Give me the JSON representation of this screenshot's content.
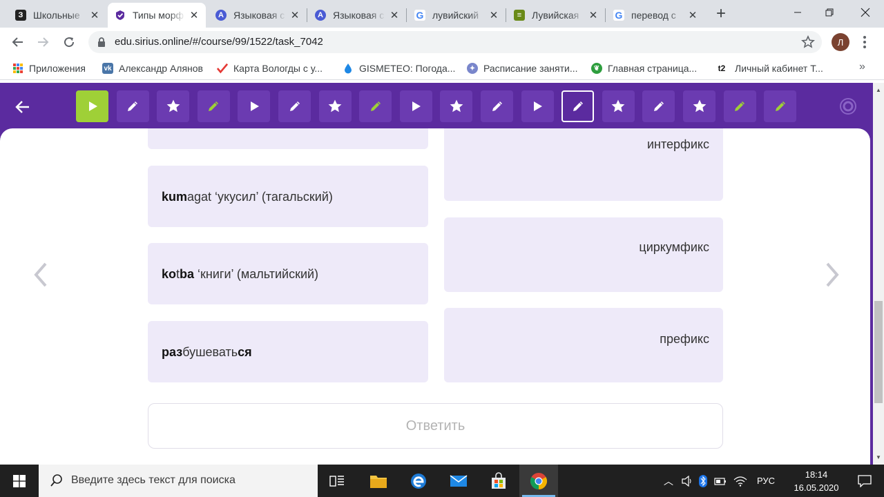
{
  "browser": {
    "tabs": [
      {
        "title": "Школьные",
        "favicon_text": "З",
        "favicon_color": "#222222"
      },
      {
        "title": "Типы морф",
        "favicon_text": "✓",
        "favicon_color": "#5b2b9f"
      },
      {
        "title": "Языковая с",
        "favicon_text": "A",
        "favicon_color": "#4a5bd4"
      },
      {
        "title": "Языковая с",
        "favicon_text": "A",
        "favicon_color": "#4a5bd4"
      },
      {
        "title": "лувийский",
        "favicon_text": "G",
        "favicon_color": "#4285f4"
      },
      {
        "title": "Лувийская",
        "favicon_text": "≡",
        "favicon_color": "#6a8a18"
      },
      {
        "title": "перевод с",
        "favicon_text": "G",
        "favicon_color": "#4285f4"
      }
    ],
    "active_tab": 1,
    "url": "edu.sirius.online/#/course/99/1522/task_7042",
    "profile_initial": "Л",
    "bookmarks": [
      {
        "label": "Приложения",
        "icon": "apps-grid-icon"
      },
      {
        "label": "Александр Алянов",
        "icon": "vk-icon"
      },
      {
        "label": "Карта Вологды с у...",
        "icon": "checkmark-icon"
      },
      {
        "label": "GISMETEO: Погода...",
        "icon": "drop-icon"
      },
      {
        "label": "Расписание заняти...",
        "icon": "crest-icon"
      },
      {
        "label": "Главная страница...",
        "icon": "leaf-icon"
      },
      {
        "label": "Личный кабинет Т...",
        "icon": "t2-icon"
      }
    ]
  },
  "app": {
    "steps": [
      {
        "icon": "play",
        "state": "current"
      },
      {
        "icon": "pencil",
        "state": "default"
      },
      {
        "icon": "star",
        "state": "default"
      },
      {
        "icon": "pencil",
        "state": "done"
      },
      {
        "icon": "play",
        "state": "default"
      },
      {
        "icon": "pencil",
        "state": "default"
      },
      {
        "icon": "star",
        "state": "default"
      },
      {
        "icon": "pencil",
        "state": "done"
      },
      {
        "icon": "play",
        "state": "default"
      },
      {
        "icon": "star",
        "state": "default"
      },
      {
        "icon": "pencil",
        "state": "default"
      },
      {
        "icon": "play",
        "state": "default"
      },
      {
        "icon": "pencil",
        "state": "selected"
      },
      {
        "icon": "star",
        "state": "default"
      },
      {
        "icon": "pencil",
        "state": "default"
      },
      {
        "icon": "star",
        "state": "default"
      },
      {
        "icon": "pencil",
        "state": "done"
      },
      {
        "icon": "pencil",
        "state": "done"
      }
    ],
    "left_cards": [
      {
        "segments": [
          {
            "text": "k",
            "bold": true
          },
          {
            "text": "um",
            "bold": true
          },
          {
            "text": "agat ‘укусил’ (тагальский)",
            "bold": false
          }
        ]
      },
      {
        "segments": [
          {
            "text": "k",
            "bold": true
          },
          {
            "text": "o",
            "bold": true
          },
          {
            "text": "t",
            "bold": false
          },
          {
            "text": "b",
            "bold": true
          },
          {
            "text": "a",
            "bold": true
          },
          {
            "text": " ‘книги’ (мальтийский)",
            "bold": false
          }
        ]
      },
      {
        "segments": [
          {
            "text": "раз",
            "bold": true
          },
          {
            "text": "бушевать",
            "bold": false
          },
          {
            "text": "ся",
            "bold": true
          }
        ]
      }
    ],
    "right_cards": [
      "интерфикс",
      "циркумфикс",
      "префикс"
    ],
    "answer_button": "Ответить",
    "colors": {
      "primary": "#5b2b9f",
      "accent": "#9fd037",
      "card": "#eeeaf9"
    }
  },
  "taskbar": {
    "search_placeholder": "Введите здесь текст для поиска",
    "language": "РУС",
    "time": "18:14",
    "date": "16.05.2020"
  }
}
